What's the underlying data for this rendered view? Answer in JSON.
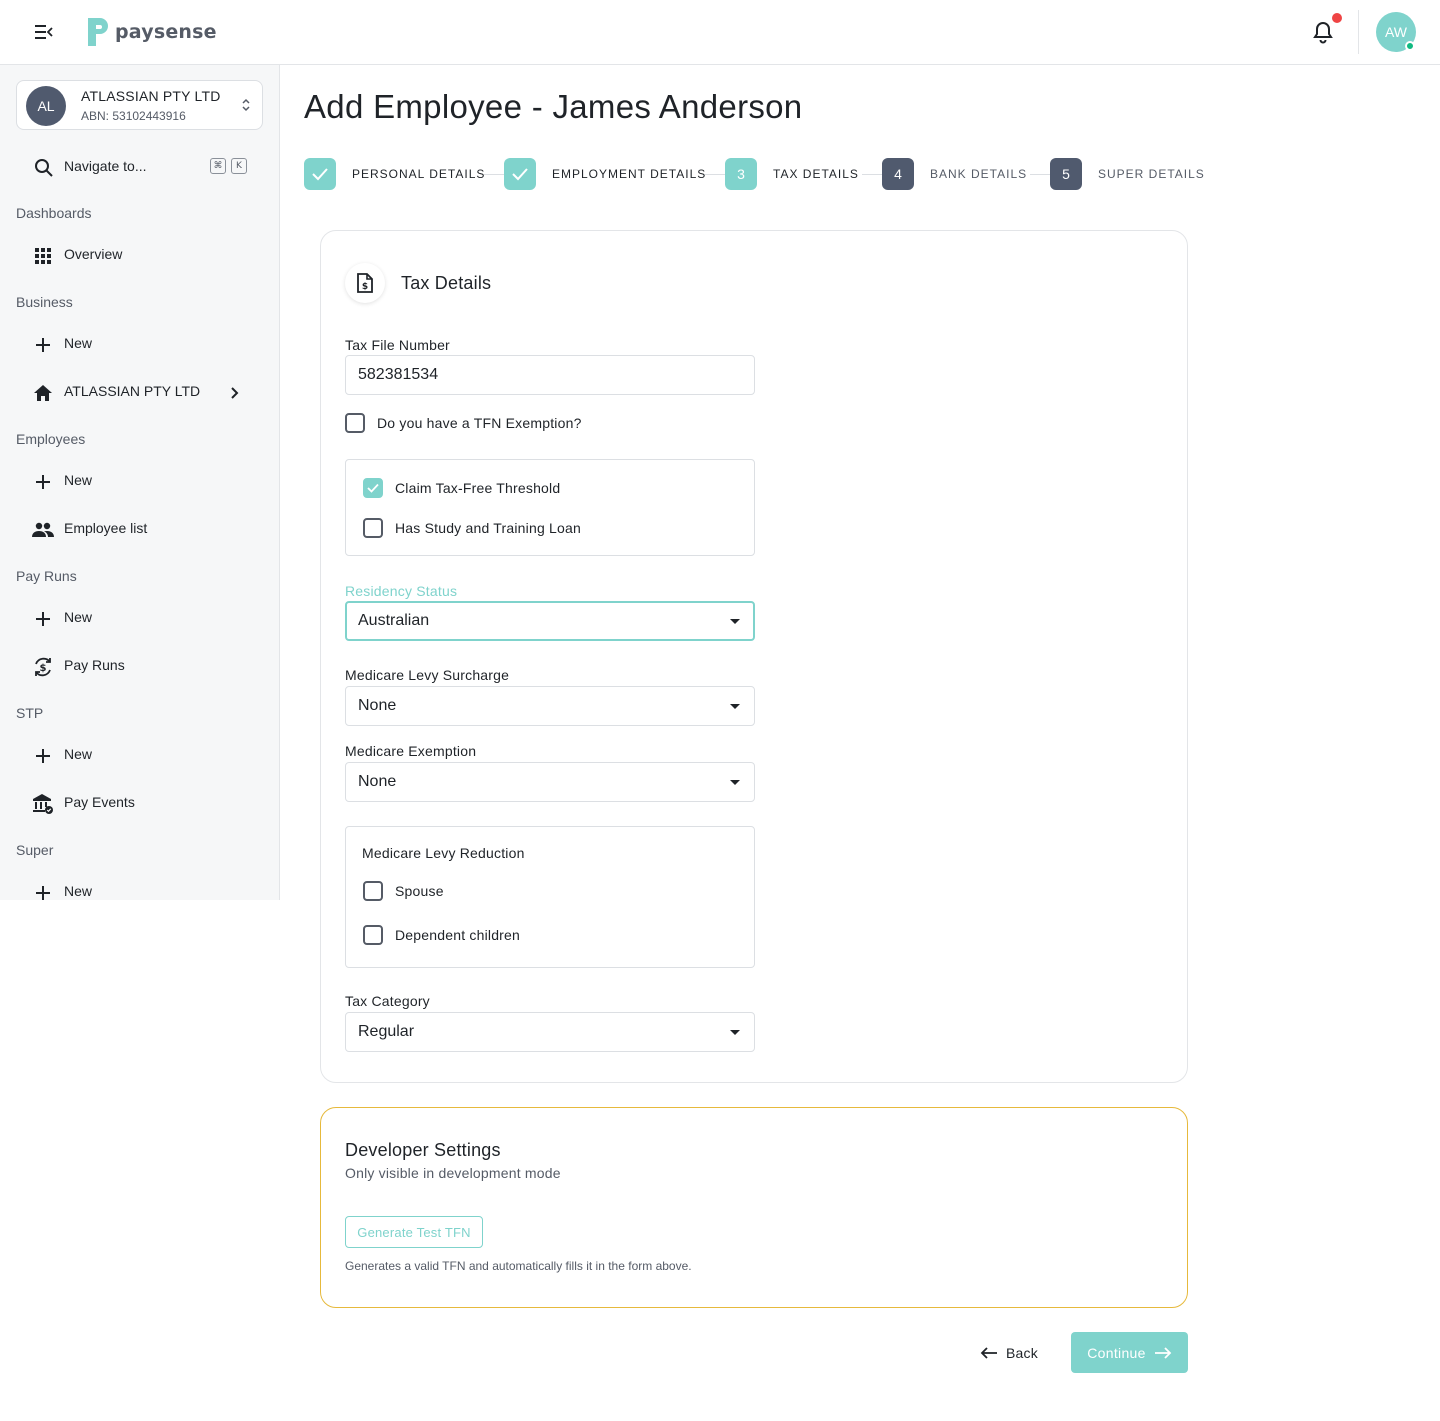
{
  "header": {
    "logo_text": "paysense",
    "user_initials": "AW",
    "colors": {
      "brand": "#7fd3cc",
      "notification": "#ef4444",
      "online": "#10b981"
    }
  },
  "sidebar": {
    "org": {
      "initials": "AL",
      "name": "ATLASSIAN PTY LTD",
      "abn": "ABN: 53102443916"
    },
    "search": {
      "label": "Navigate to...",
      "shortcut_mod": "⌘",
      "shortcut_key": "K"
    },
    "sections": {
      "dashboards": "Dashboards",
      "business": "Business",
      "employees": "Employees",
      "pay_runs": "Pay Runs",
      "stp": "STP",
      "super": "Super"
    },
    "items": {
      "overview": "Overview",
      "business_new": "New",
      "business_org": "ATLASSIAN PTY LTD",
      "employees_new": "New",
      "employee_list": "Employee list",
      "payruns_new": "New",
      "pay_runs": "Pay Runs",
      "stp_new": "New",
      "pay_events": "Pay Events",
      "super_new": "New"
    }
  },
  "page": {
    "title": "Add Employee - James Anderson"
  },
  "stepper": {
    "steps": [
      {
        "label": "PERSONAL DETAILS",
        "status": "done"
      },
      {
        "label": "EMPLOYMENT DETAILS",
        "status": "done"
      },
      {
        "number": "3",
        "label": "TAX DETAILS",
        "status": "active"
      },
      {
        "number": "4",
        "label": "BANK DETAILS",
        "status": "pending"
      },
      {
        "number": "5",
        "label": "SUPER DETAILS",
        "status": "pending"
      }
    ]
  },
  "tax_card": {
    "title": "Tax Details",
    "tfn_label": "Tax File Number",
    "tfn_value": "582381534",
    "tfn_exemption_label": "Do you have a TFN Exemption?",
    "claim_threshold_label": "Claim Tax-Free Threshold",
    "study_loan_label": "Has Study and Training Loan",
    "residency_label": "Residency Status",
    "residency_value": "Australian",
    "surcharge_label": "Medicare Levy Surcharge",
    "surcharge_value": "None",
    "exemption_label": "Medicare Exemption",
    "exemption_value": "None",
    "reduction_title": "Medicare Levy Reduction",
    "spouse_label": "Spouse",
    "dependents_label": "Dependent children",
    "category_label": "Tax Category",
    "category_value": "Regular"
  },
  "dev_settings": {
    "title": "Developer Settings",
    "subtitle": "Only visible in development mode",
    "button_label": "Generate Test TFN",
    "note": "Generates a valid TFN and automatically fills it in the form above.",
    "border_color": "#e6b93c"
  },
  "footer": {
    "back_label": "Back",
    "continue_label": "Continue"
  }
}
